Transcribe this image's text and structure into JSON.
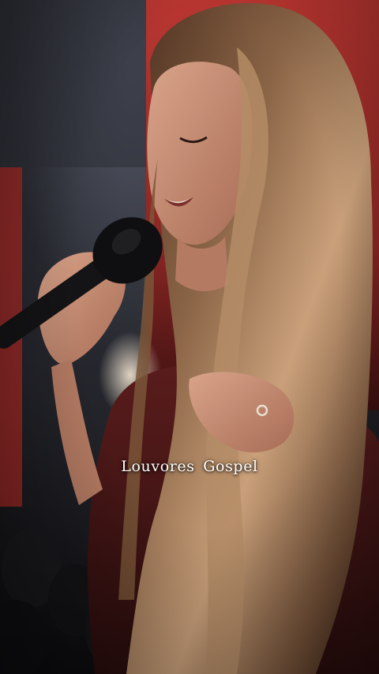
{
  "video": {
    "caption": "Louvores Gospel"
  },
  "colors": {
    "backdrop_red": "#b8322f",
    "hair_light": "#c9a07a",
    "hair_dark": "#3b2418",
    "skin": "#c9927a",
    "microphone": "#141416"
  }
}
